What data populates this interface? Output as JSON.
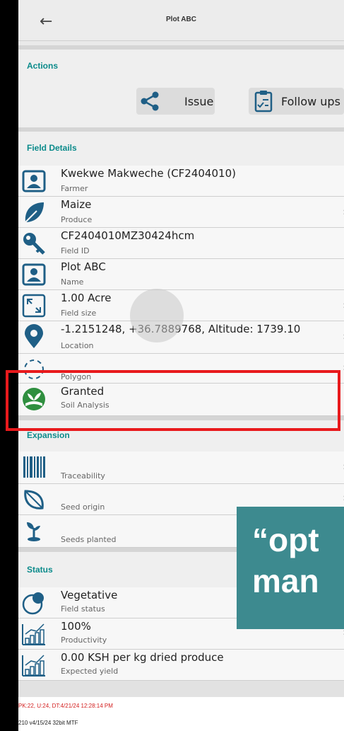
{
  "header": {
    "title": "Plot ABC",
    "back_icon": "arrow-left-icon"
  },
  "actions": {
    "title": "Actions",
    "buttons": [
      {
        "label": "Issue",
        "icon": "share-icon"
      },
      {
        "label": "Follow ups",
        "icon": "clipboard-icon"
      }
    ]
  },
  "field_details": {
    "title": "Field Details",
    "rows": [
      {
        "value": "Kwekwe Makweche (CF2404010)",
        "label": "Farmer",
        "icon": "person-card-icon"
      },
      {
        "value": "Maize",
        "label": "Produce",
        "icon": "leaf-icon"
      },
      {
        "value": "CF2404010MZ30424hcm",
        "label": "Field ID",
        "icon": "key-icon"
      },
      {
        "value": "Plot ABC",
        "label": "Name",
        "icon": "person-card-icon"
      },
      {
        "value": "1.00 Acre",
        "label": "Field size",
        "icon": "resize-icon"
      },
      {
        "value": "-1.2151248, +36.7889768, Altitude: 1739.10",
        "label": "Location",
        "icon": "location-pin-icon"
      },
      {
        "value": "",
        "label": "Polygon",
        "icon": "polygon-icon"
      },
      {
        "value": "Granted",
        "label": "Soil Analysis",
        "icon": "soil-plant-icon"
      }
    ]
  },
  "expansion": {
    "title": "Expansion",
    "rows": [
      {
        "label": "Traceability",
        "icon": "barcode-icon"
      },
      {
        "label": "Seed origin",
        "icon": "seed-leaf-icon"
      },
      {
        "label": "Seeds planted",
        "icon": "sprout-icon"
      }
    ]
  },
  "status": {
    "title": "Status",
    "rows": [
      {
        "value": "Vegetative",
        "label": "Field status",
        "icon": "growth-icon"
      },
      {
        "value": "100%",
        "label": "Productivity",
        "icon": "bar-chart-icon"
      },
      {
        "value": "0.00 KSH per kg dried produce",
        "label": "Expected yield",
        "icon": "bar-chart-icon"
      }
    ]
  },
  "footer": {
    "debug_line": "PK:22, U:24, DT:4/21/24 12:28:14 PM",
    "version_line": "210 v4/15/24 32bit MTF"
  },
  "overlay": {
    "line1": "“opt",
    "line2": "man"
  },
  "colors": {
    "accent": "#0b8b8b",
    "icon_blue": "#1f5f86",
    "highlight": "#e8191c",
    "overlay_bg": "#3d8a8f"
  }
}
